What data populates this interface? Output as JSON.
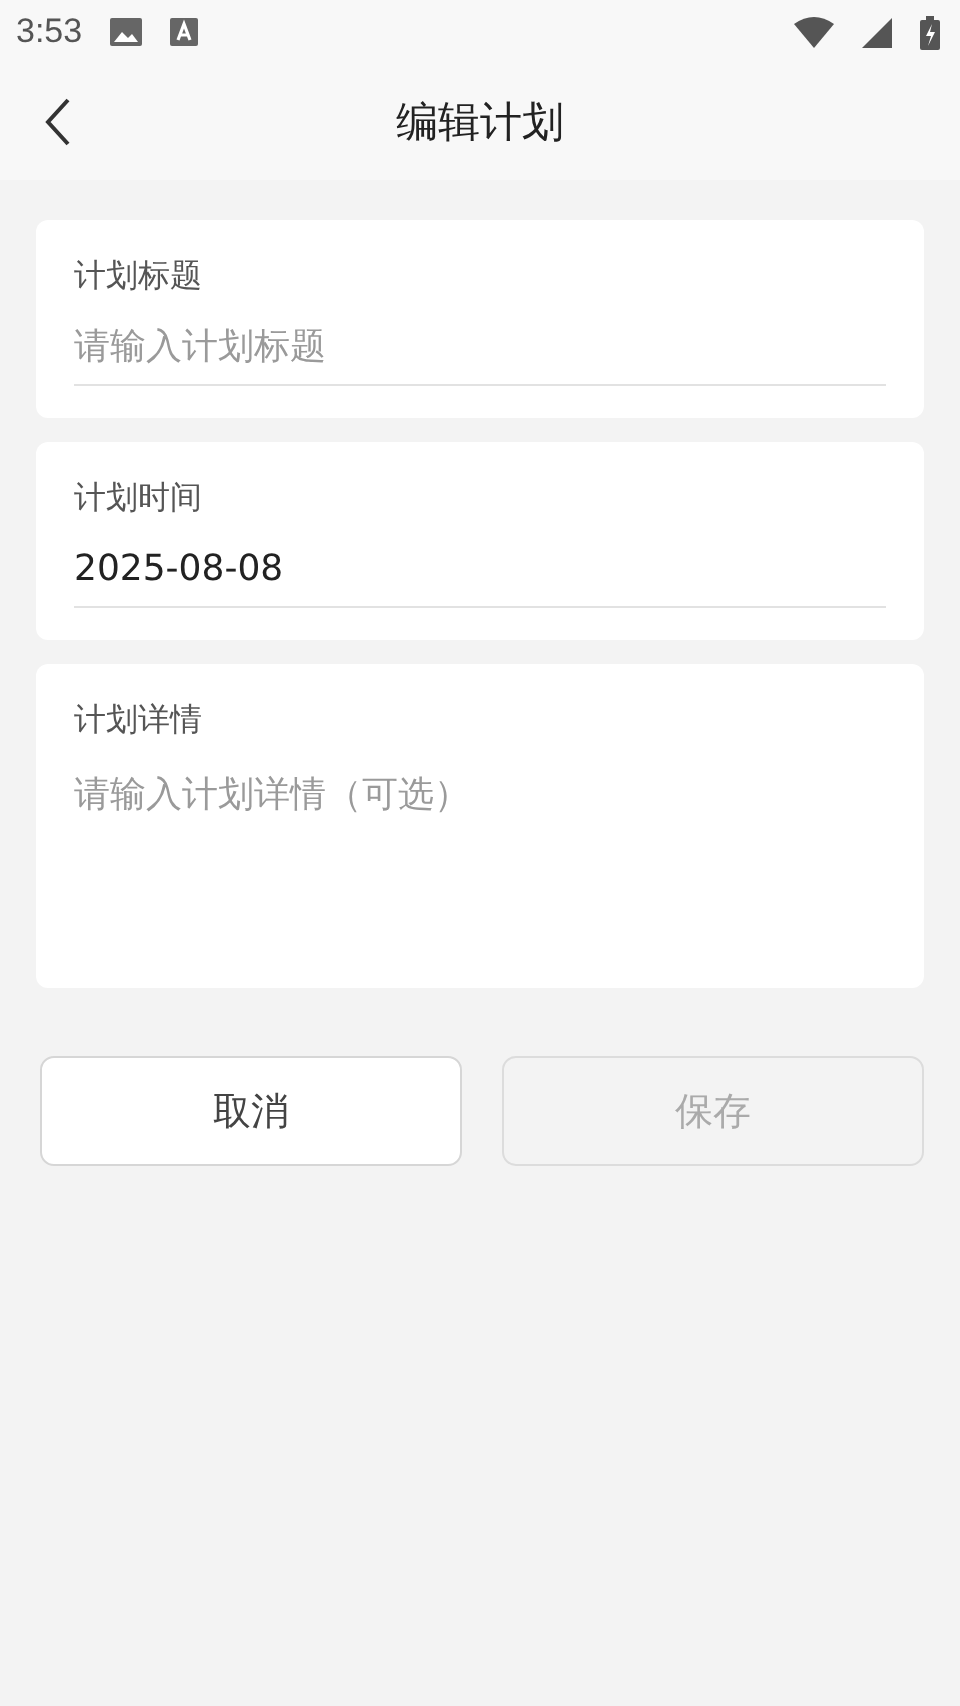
{
  "status_bar": {
    "time": "3:53"
  },
  "header": {
    "title": "编辑计划"
  },
  "fields": [
    {
      "kind": "line",
      "label": "计划标题",
      "placeholder": "请输入计划标题"
    },
    {
      "kind": "line",
      "label": "计划时间",
      "value": "2025-08-08"
    },
    {
      "kind": "area",
      "label": "计划详情",
      "placeholder": "请输入计划详情（可选）"
    }
  ],
  "buttons": [
    {
      "label": "取消",
      "disabled": false
    },
    {
      "label": "保存",
      "disabled": true
    }
  ]
}
